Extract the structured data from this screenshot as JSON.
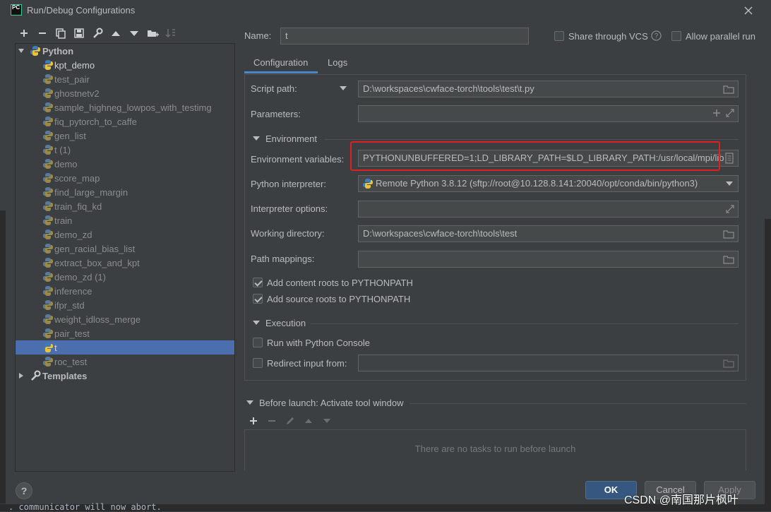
{
  "window": {
    "title": "Run/Debug Configurations",
    "app_icon_text": "PC"
  },
  "tree": {
    "root_label": "Python",
    "items": [
      {
        "label": "kpt_demo",
        "style": "white"
      },
      {
        "label": "test_pair",
        "style": "dim"
      },
      {
        "label": "ghostnetv2",
        "style": "dim"
      },
      {
        "label": "sample_highneg_lowpos_with_testimg",
        "style": "dim"
      },
      {
        "label": "fiq_pytorch_to_caffe",
        "style": "dim"
      },
      {
        "label": "gen_list",
        "style": "dim"
      },
      {
        "label": "t (1)",
        "style": "dim"
      },
      {
        "label": "demo",
        "style": "dim"
      },
      {
        "label": "score_map",
        "style": "dim"
      },
      {
        "label": "find_large_margin",
        "style": "dim"
      },
      {
        "label": "train_fiq_kd",
        "style": "dim"
      },
      {
        "label": "train",
        "style": "dim"
      },
      {
        "label": "demo_zd",
        "style": "dim"
      },
      {
        "label": "gen_racial_bias_list",
        "style": "dim"
      },
      {
        "label": "extract_box_and_kpt",
        "style": "dim"
      },
      {
        "label": "demo_zd (1)",
        "style": "dim"
      },
      {
        "label": "inference",
        "style": "dim"
      },
      {
        "label": "ifpr_std",
        "style": "dim"
      },
      {
        "label": "weight_idloss_merge",
        "style": "dim"
      },
      {
        "label": "pair_test",
        "style": "dim"
      },
      {
        "label": "t",
        "style": "selected"
      },
      {
        "label": "roc_test",
        "style": "dim"
      }
    ],
    "templates_label": "Templates"
  },
  "header": {
    "name_label": "Name:",
    "name_value": "t",
    "share_vcs_label": "Share through VCS",
    "allow_parallel_label": "Allow parallel run"
  },
  "tabs": [
    "Configuration",
    "Logs"
  ],
  "config": {
    "script_path_label": "Script path:",
    "script_path_value": "D:\\workspaces\\cwface-torch\\tools\\test\\t.py",
    "parameters_label": "Parameters:",
    "parameters_value": "",
    "environment_section": "Environment",
    "env_vars_label": "Environment variables:",
    "env_vars_value": "PYTHONUNBUFFERED=1;LD_LIBRARY_PATH=$LD_LIBRARY_PATH:/usr/local/mpi/lib",
    "interpreter_label": "Python interpreter:",
    "interpreter_value": "Remote Python 3.8.12 (sftp://root@10.128.8.141:20040/opt/conda/bin/python3)",
    "interpreter_options_label": "Interpreter options:",
    "interpreter_options_value": "",
    "working_dir_label": "Working directory:",
    "working_dir_value": "D:\\workspaces\\cwface-torch\\tools\\test",
    "path_mappings_label": "Path mappings:",
    "path_mappings_value": "",
    "add_content_roots_label": "Add content roots to PYTHONPATH",
    "add_content_roots_checked": true,
    "add_source_roots_label": "Add source roots to PYTHONPATH",
    "add_source_roots_checked": true,
    "execution_section": "Execution",
    "run_console_label": "Run with Python Console",
    "run_console_checked": false,
    "redirect_input_label": "Redirect input from:",
    "redirect_input_checked": false,
    "redirect_input_value": ""
  },
  "before_launch": {
    "header": "Before launch: Activate tool window",
    "empty_text": "There are no tasks to run before launch"
  },
  "buttons": {
    "help": "?",
    "ok": "OK",
    "cancel": "Cancel",
    "apply": "Apply"
  },
  "background": {
    "bottom_text": ". communicator will now abort."
  },
  "watermark": "CSDN @南国那片枫叶",
  "colors": {
    "dialog_bg": "#3c3f41",
    "selection": "#4b6eaf",
    "highlight_box": "#e02020",
    "ok_button": "#365880"
  }
}
